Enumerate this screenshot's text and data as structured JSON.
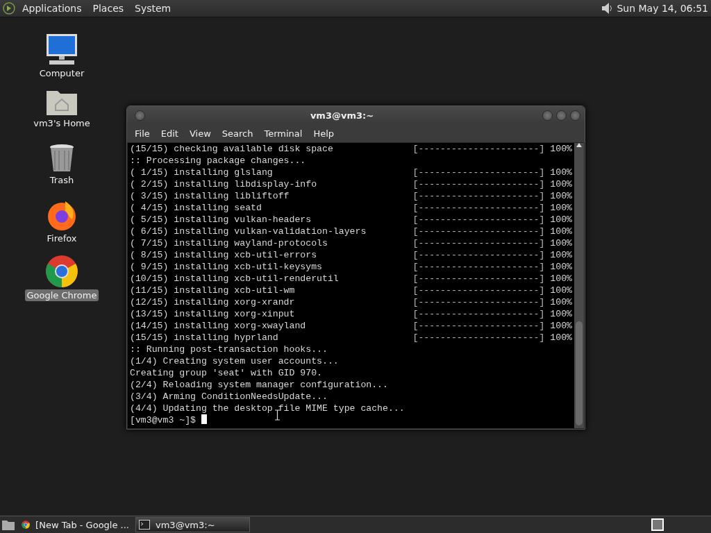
{
  "top_panel": {
    "menus": [
      "Applications",
      "Places",
      "System"
    ],
    "clock": "Sun May 14, 06:51"
  },
  "desktop_icons": [
    {
      "kind": "computer",
      "label": "Computer",
      "selected": false
    },
    {
      "kind": "home",
      "label": "vm3's Home",
      "selected": false
    },
    {
      "kind": "trash",
      "label": "Trash",
      "selected": false
    },
    {
      "kind": "firefox",
      "label": "Firefox",
      "selected": false
    },
    {
      "kind": "chrome",
      "label": "Google Chrome",
      "selected": true
    }
  ],
  "terminal": {
    "title": "vm3@vm3:~",
    "menu": [
      "File",
      "Edit",
      "View",
      "Search",
      "Terminal",
      "Help"
    ],
    "lines": [
      {
        "text": "(15/15) checking available disk space",
        "bar": "[----------------------]",
        "percent": "100%"
      },
      {
        "text": ":: Processing package changes..."
      },
      {
        "text": "( 1/15) installing glslang",
        "bar": "[----------------------]",
        "percent": "100%"
      },
      {
        "text": "( 2/15) installing libdisplay-info",
        "bar": "[----------------------]",
        "percent": "100%"
      },
      {
        "text": "( 3/15) installing libliftoff",
        "bar": "[----------------------]",
        "percent": "100%"
      },
      {
        "text": "( 4/15) installing seatd",
        "bar": "[----------------------]",
        "percent": "100%"
      },
      {
        "text": "( 5/15) installing vulkan-headers",
        "bar": "[----------------------]",
        "percent": "100%"
      },
      {
        "text": "( 6/15) installing vulkan-validation-layers",
        "bar": "[----------------------]",
        "percent": "100%"
      },
      {
        "text": "( 7/15) installing wayland-protocols",
        "bar": "[----------------------]",
        "percent": "100%"
      },
      {
        "text": "( 8/15) installing xcb-util-errors",
        "bar": "[----------------------]",
        "percent": "100%"
      },
      {
        "text": "( 9/15) installing xcb-util-keysyms",
        "bar": "[----------------------]",
        "percent": "100%"
      },
      {
        "text": "(10/15) installing xcb-util-renderutil",
        "bar": "[----------------------]",
        "percent": "100%"
      },
      {
        "text": "(11/15) installing xcb-util-wm",
        "bar": "[----------------------]",
        "percent": "100%"
      },
      {
        "text": "(12/15) installing xorg-xrandr",
        "bar": "[----------------------]",
        "percent": "100%"
      },
      {
        "text": "(13/15) installing xorg-xinput",
        "bar": "[----------------------]",
        "percent": "100%"
      },
      {
        "text": "(14/15) installing xorg-xwayland",
        "bar": "[----------------------]",
        "percent": "100%"
      },
      {
        "text": "(15/15) installing hyprland",
        "bar": "[----------------------]",
        "percent": "100%"
      },
      {
        "text": ":: Running post-transaction hooks..."
      },
      {
        "text": "(1/4) Creating system user accounts..."
      },
      {
        "text": "Creating group 'seat' with GID 970."
      },
      {
        "text": "(2/4) Reloading system manager configuration..."
      },
      {
        "text": "(3/4) Arming ConditionNeedsUpdate..."
      },
      {
        "text": "(4/4) Updating the desktop file MIME type cache..."
      }
    ],
    "prompt": "[vm3@vm3 ~]$"
  },
  "taskbar": {
    "tasks": [
      {
        "kind": "browser",
        "label": "[New Tab - Google ...",
        "selected": false
      },
      {
        "kind": "terminal",
        "label": "vm3@vm3:~",
        "selected": true
      }
    ]
  }
}
